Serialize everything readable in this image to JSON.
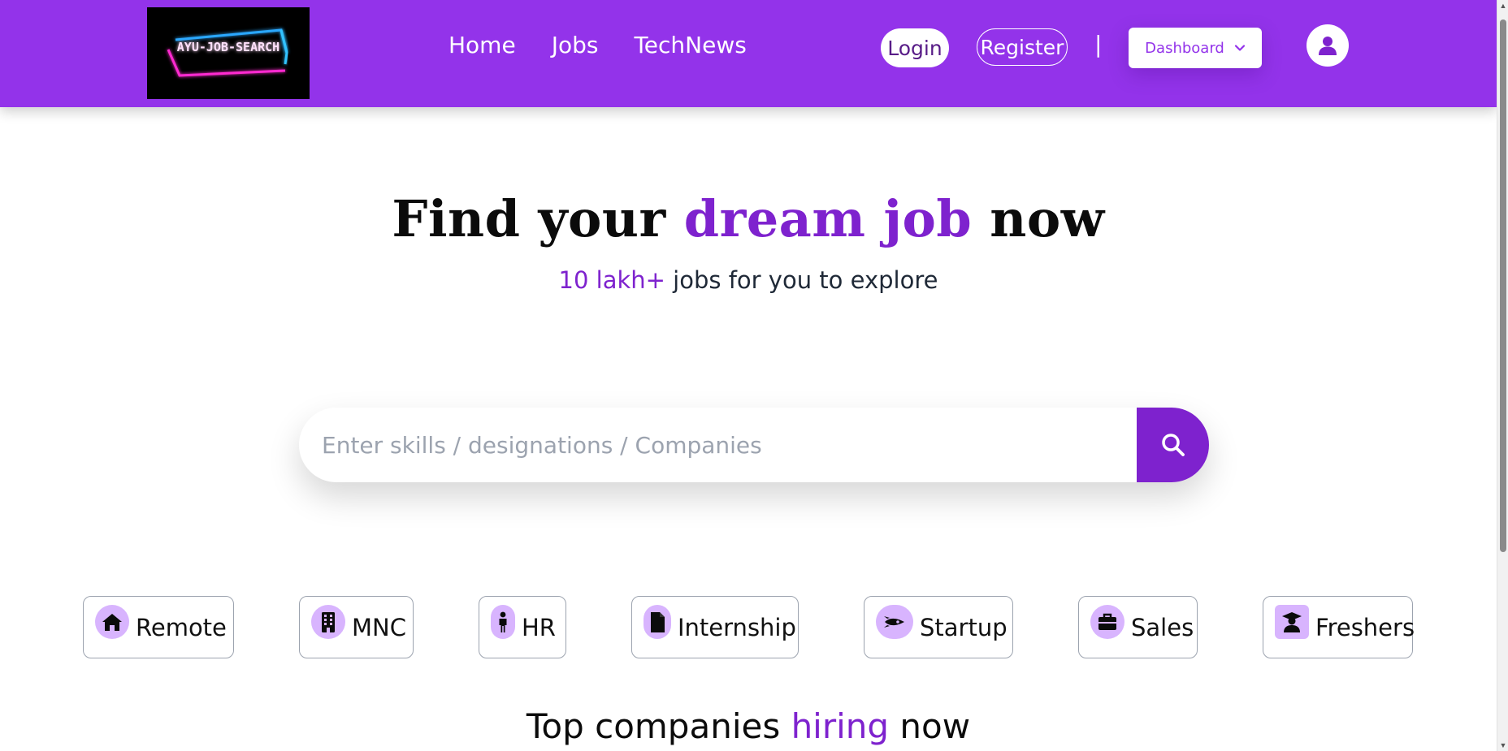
{
  "brand": {
    "logo_text": "AYU-JOB-SEARCH",
    "primary_color": "#9333ea",
    "accent_color": "#7e22ce"
  },
  "nav": {
    "links": [
      "Home",
      "Jobs",
      "TechNews"
    ],
    "login_label": "Login",
    "register_label": "Register",
    "separator": "|",
    "dashboard_label": "Dashboard",
    "dashboard_icon": "chevron-down-icon",
    "avatar_icon": "user-icon"
  },
  "hero": {
    "title_part1": "Find your ",
    "title_accent": "dream job",
    "title_part2": " now",
    "sub_accent": "10 lakh+",
    "sub_rest": " jobs for you to explore"
  },
  "search": {
    "placeholder": "Enter skills / designations / Companies",
    "value": "",
    "button_icon": "search-icon"
  },
  "categories": [
    {
      "label": "Remote",
      "icon": "home-icon"
    },
    {
      "label": "MNC",
      "icon": "building-icon"
    },
    {
      "label": "HR",
      "icon": "person-icon"
    },
    {
      "label": "Internship",
      "icon": "file-icon"
    },
    {
      "label": "Startup",
      "icon": "rocket-icon"
    },
    {
      "label": "Sales",
      "icon": "briefcase-icon"
    },
    {
      "label": "Freshers",
      "icon": "graduate-icon"
    }
  ],
  "section": {
    "title_part1": "Top companies ",
    "title_accent": "hiring",
    "title_part2": " now"
  }
}
